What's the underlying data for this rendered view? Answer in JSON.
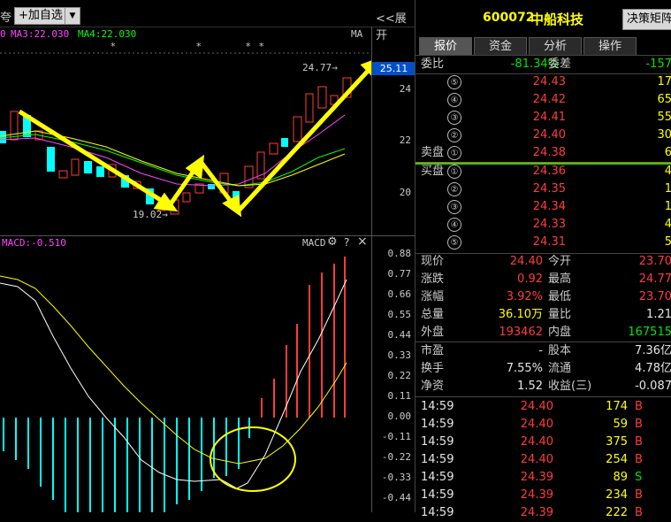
{
  "toolbar": {
    "left_fragment": "夸",
    "add_watch_label": "加自选",
    "add_watch_plus": "+",
    "dropdown_arrow": "▼",
    "expand_label": "<<展开",
    "strategy_button": "决策矩阵"
  },
  "ma_line": {
    "ma_prefix": "0",
    "ma3": "MA3:22.030",
    "ma4": "MA4:22.030",
    "right_label": "MA"
  },
  "price_axis": {
    "highlight": "25.11",
    "ticks": [
      "24",
      "22",
      "20"
    ]
  },
  "annotations": {
    "high_label": "24.77→",
    "low_label": "19.02→"
  },
  "macd_header": {
    "label": "MACD:-0.510",
    "right_label": "MACD",
    "gear": "⚙",
    "question": "?",
    "close": "×"
  },
  "macd_axis": [
    "0.88",
    "0.77",
    "0.66",
    "0.55",
    "0.44",
    "0.33",
    "0.22",
    "0.11",
    "0.00",
    "-0.11",
    "-0.22",
    "-0.33",
    "-0.44"
  ],
  "stock": {
    "code": "600072",
    "name": "中船科技"
  },
  "tabs": [
    "报价",
    "资金",
    "分析",
    "操作"
  ],
  "weibi": {
    "label": "委比",
    "value": "-81.34%",
    "label2": "委差",
    "value2": "-157"
  },
  "sell_orders": [
    {
      "num": "⑤",
      "price": "24.43",
      "vol": "17"
    },
    {
      "num": "④",
      "price": "24.42",
      "vol": "65"
    },
    {
      "num": "③",
      "price": "24.41",
      "vol": "55"
    },
    {
      "num": "②",
      "price": "24.40",
      "vol": "30"
    },
    {
      "num": "①",
      "price": "24.38",
      "vol": "6"
    }
  ],
  "sell_label": "卖盘",
  "buy_label": "买盘",
  "buy_orders": [
    {
      "num": "①",
      "price": "24.36",
      "vol": "4"
    },
    {
      "num": "②",
      "price": "24.35",
      "vol": "1"
    },
    {
      "num": "③",
      "price": "24.34",
      "vol": "1"
    },
    {
      "num": "④",
      "price": "24.33",
      "vol": "4"
    },
    {
      "num": "⑤",
      "price": "24.31",
      "vol": "5"
    }
  ],
  "quote": [
    {
      "l1": "现价",
      "v1": "24.40",
      "c1": "red",
      "l2": "今开",
      "v2": "23.70",
      "c2": "red"
    },
    {
      "l1": "涨跌",
      "v1": "0.92",
      "c1": "red",
      "l2": "最高",
      "v2": "24.77",
      "c2": "red"
    },
    {
      "l1": "涨幅",
      "v1": "3.92%",
      "c1": "red",
      "l2": "最低",
      "v2": "23.70",
      "c2": "red"
    },
    {
      "l1": "总量",
      "v1": "36.10万",
      "c1": "yellow",
      "l2": "量比",
      "v2": "1.21",
      "c2": "white"
    },
    {
      "l1": "外盘",
      "v1": "193462",
      "c1": "red",
      "l2": "内盘",
      "v2": "167515",
      "c2": "green"
    }
  ],
  "fundamentals": [
    {
      "l1": "市盈",
      "v1": "-",
      "l2": "股本",
      "v2": "7.36亿"
    },
    {
      "l1": "换手",
      "v1": "7.55%",
      "l2": "流通",
      "v2": "4.78亿"
    },
    {
      "l1": "净资",
      "v1": "1.52",
      "l2": "收益(三)",
      "v2": "-0.087"
    }
  ],
  "ticks": [
    {
      "time": "14:59",
      "price": "24.40",
      "vol": "174",
      "dir": "B"
    },
    {
      "time": "14:59",
      "price": "24.40",
      "vol": "59",
      "dir": "B"
    },
    {
      "time": "14:59",
      "price": "24.40",
      "vol": "375",
      "dir": "B"
    },
    {
      "time": "14:59",
      "price": "24.40",
      "vol": "254",
      "dir": "B"
    },
    {
      "time": "14:59",
      "price": "24.39",
      "vol": "89",
      "dir": "S"
    },
    {
      "time": "14:59",
      "price": "24.39",
      "vol": "234",
      "dir": "B"
    },
    {
      "time": "14:59",
      "price": "24.39",
      "vol": "222",
      "dir": "B"
    }
  ],
  "colors": {
    "up": "#ff3c3c",
    "down": "#00ffff",
    "accent": "#ffff00",
    "macd_dif": "#ffffff",
    "macd_dea": "#ffff00"
  }
}
